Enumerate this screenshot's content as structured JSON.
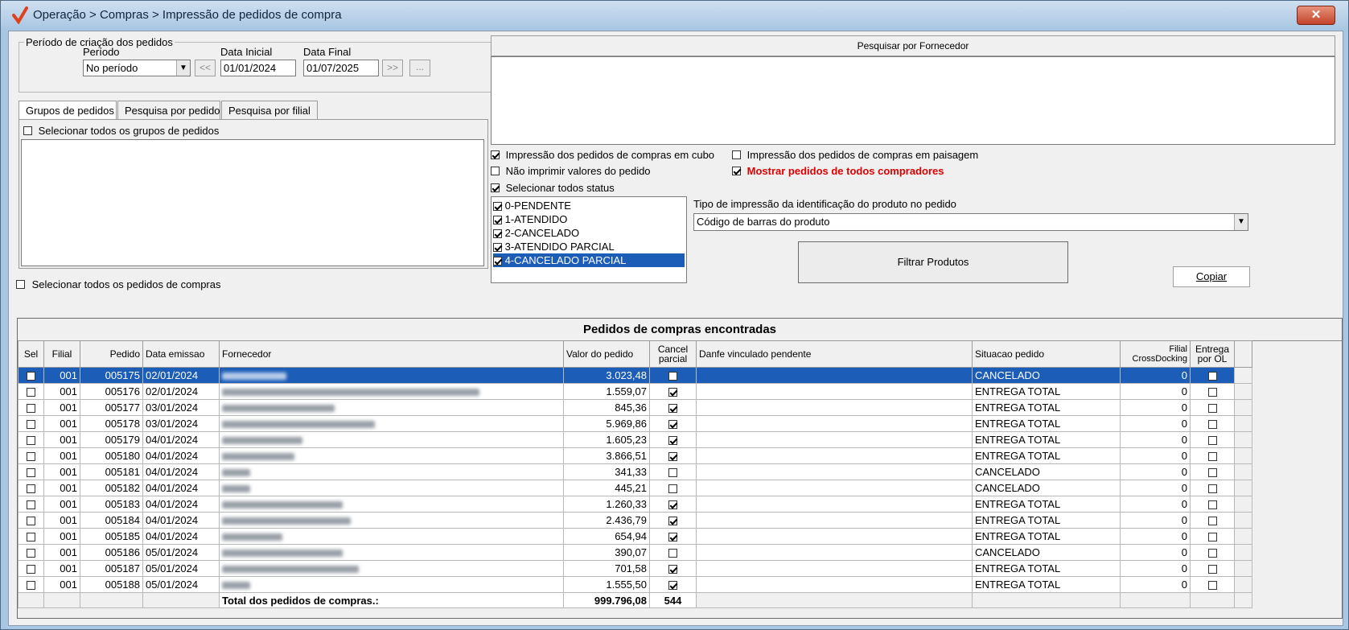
{
  "window": {
    "title": "Operação > Compras > Impressão de pedidos de compra",
    "close": "✕"
  },
  "periodo": {
    "group_title": "Período de criação dos pedidos",
    "periodo_label": "Período",
    "periodo_value": "No período",
    "data_inicial_label": "Data Inicial",
    "data_inicial_value": "01/01/2024",
    "data_final_label": "Data Final",
    "data_final_value": "01/07/2025",
    "prev_btn": "<<",
    "next_btn": ">>",
    "more_btn": "..."
  },
  "tabs": [
    "Grupos de pedidos",
    "Pesquisa por pedido",
    "Pesquisa por filial"
  ],
  "grupos": {
    "select_all": "Selecionar todos os grupos de pedidos",
    "checked": false
  },
  "select_all_pedidos": "Selecionar todos os pedidos de compras",
  "fornecedor": {
    "header": "Pesquisar por Fornecedor"
  },
  "options": {
    "cubo": {
      "label": "Impressão dos pedidos de compras em cubo",
      "checked": true
    },
    "nao_imprimir": {
      "label": "Não imprimir valores do pedido",
      "checked": false
    },
    "paisagem": {
      "label": "Impressão dos pedidos de compras em paisagem",
      "checked": false
    },
    "mostrar_todos": {
      "label": "Mostrar pedidos de todos compradores",
      "checked": true,
      "color": "#e00000"
    },
    "todos_status": {
      "label": "Selecionar todos status",
      "checked": true
    }
  },
  "status_list": [
    {
      "label": "0-PENDENTE",
      "checked": true
    },
    {
      "label": "1-ATENDIDO",
      "checked": true
    },
    {
      "label": "2-CANCELADO",
      "checked": true
    },
    {
      "label": "3-ATENDIDO PARCIAL",
      "checked": true
    },
    {
      "label": "4-CANCELADO PARCIAL",
      "checked": true,
      "selected": true
    }
  ],
  "tipo_impressao": {
    "label": "Tipo de impressão da identificação do produto no pedido",
    "value": "Código de barras do produto"
  },
  "filtrar_btn": "Filtrar Produtos",
  "copiar_btn": "Copiar",
  "grid": {
    "caption": "Pedidos de compras encontradas",
    "headers": [
      "Sel",
      "Filial",
      "Pedido",
      "Data emissao",
      "Fornecedor",
      "Valor do pedido",
      "Cancel parcial",
      "Danfe vinculado pendente",
      "Situacao pedido",
      "Filial CrossDocking",
      "Entrega por OL"
    ],
    "rows": [
      {
        "filial": "001",
        "pedido": "005175",
        "data": "02/01/2024",
        "valor": "3.023,48",
        "cancel": false,
        "situacao": "CANCELADO",
        "cross": "0",
        "selected": true
      },
      {
        "filial": "001",
        "pedido": "005176",
        "data": "02/01/2024",
        "valor": "1.559,07",
        "cancel": true,
        "situacao": "ENTREGA TOTAL",
        "cross": "0"
      },
      {
        "filial": "001",
        "pedido": "005177",
        "data": "03/01/2024",
        "valor": "845,36",
        "cancel": true,
        "situacao": "ENTREGA TOTAL",
        "cross": "0"
      },
      {
        "filial": "001",
        "pedido": "005178",
        "data": "03/01/2024",
        "valor": "5.969,86",
        "cancel": true,
        "situacao": "ENTREGA TOTAL",
        "cross": "0"
      },
      {
        "filial": "001",
        "pedido": "005179",
        "data": "04/01/2024",
        "valor": "1.605,23",
        "cancel": true,
        "situacao": "ENTREGA TOTAL",
        "cross": "0"
      },
      {
        "filial": "001",
        "pedido": "005180",
        "data": "04/01/2024",
        "valor": "3.866,51",
        "cancel": true,
        "situacao": "ENTREGA TOTAL",
        "cross": "0"
      },
      {
        "filial": "001",
        "pedido": "005181",
        "data": "04/01/2024",
        "valor": "341,33",
        "cancel": false,
        "situacao": "CANCELADO",
        "cross": "0"
      },
      {
        "filial": "001",
        "pedido": "005182",
        "data": "04/01/2024",
        "valor": "445,21",
        "cancel": false,
        "situacao": "CANCELADO",
        "cross": "0"
      },
      {
        "filial": "001",
        "pedido": "005183",
        "data": "04/01/2024",
        "valor": "1.260,33",
        "cancel": true,
        "situacao": "ENTREGA TOTAL",
        "cross": "0"
      },
      {
        "filial": "001",
        "pedido": "005184",
        "data": "04/01/2024",
        "valor": "2.436,79",
        "cancel": true,
        "situacao": "ENTREGA TOTAL",
        "cross": "0"
      },
      {
        "filial": "001",
        "pedido": "005185",
        "data": "04/01/2024",
        "valor": "654,94",
        "cancel": true,
        "situacao": "ENTREGA TOTAL",
        "cross": "0"
      },
      {
        "filial": "001",
        "pedido": "005186",
        "data": "05/01/2024",
        "valor": "390,07",
        "cancel": false,
        "situacao": "CANCELADO",
        "cross": "0"
      },
      {
        "filial": "001",
        "pedido": "005187",
        "data": "05/01/2024",
        "valor": "701,58",
        "cancel": true,
        "situacao": "ENTREGA TOTAL",
        "cross": "0"
      },
      {
        "filial": "001",
        "pedido": "005188",
        "data": "05/01/2024",
        "valor": "1.555,50",
        "cancel": true,
        "situacao": "ENTREGA TOTAL",
        "cross": "0"
      }
    ],
    "total_label": "Total dos pedidos de compras.:",
    "total_valor": "999.796,08",
    "total_count": "544"
  }
}
